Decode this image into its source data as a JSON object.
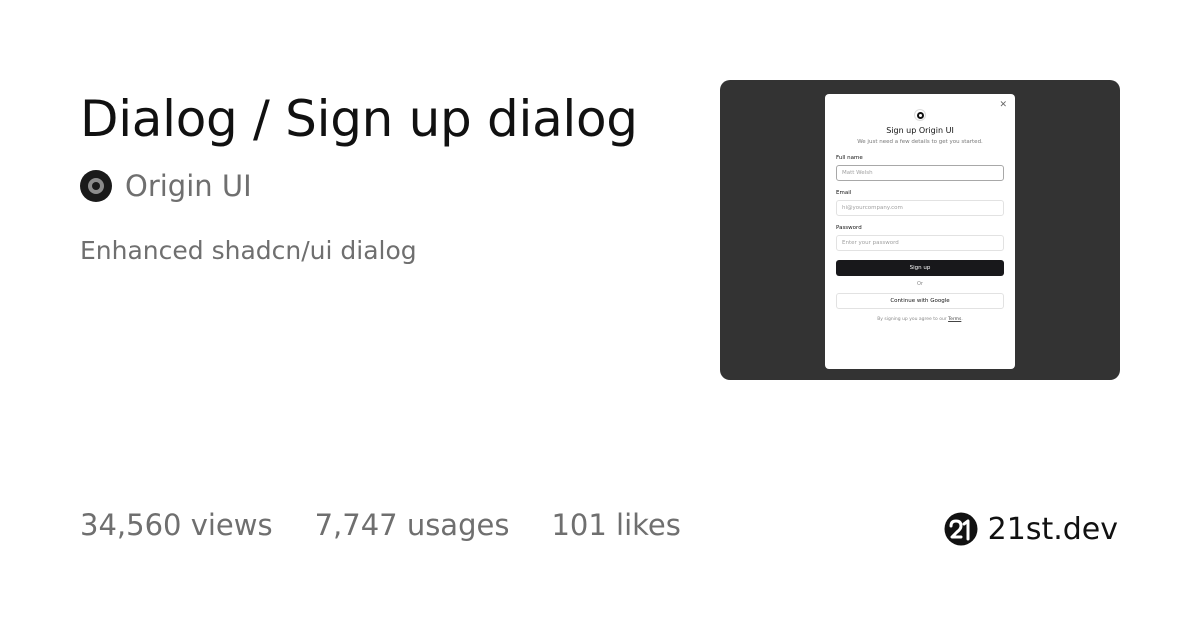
{
  "card": {
    "title": "Dialog / Sign up dialog",
    "author": "Origin UI",
    "description": "Enhanced shadcn/ui dialog",
    "stats": {
      "views": "34,560 views",
      "usages": "7,747 usages",
      "likes": "101 likes"
    },
    "brand": "21st.dev"
  },
  "preview": {
    "background_color": "#333333",
    "dialog": {
      "close_icon": "close-icon",
      "logo_icon": "origin-logo-icon",
      "title": "Sign up Origin UI",
      "subtitle": "We just need a few details to get you started.",
      "fields": [
        {
          "label": "Full name",
          "placeholder": "Matt Welsh"
        },
        {
          "label": "Email",
          "placeholder": "hi@yourcompany.com"
        },
        {
          "label": "Password",
          "placeholder": "Enter your password"
        }
      ],
      "primary_button": "Sign up",
      "divider_text": "Or",
      "secondary_button": "Continue with Google",
      "terms_prefix": "By signing up you agree to our ",
      "terms_link": "Terms",
      "terms_suffix": "."
    }
  }
}
